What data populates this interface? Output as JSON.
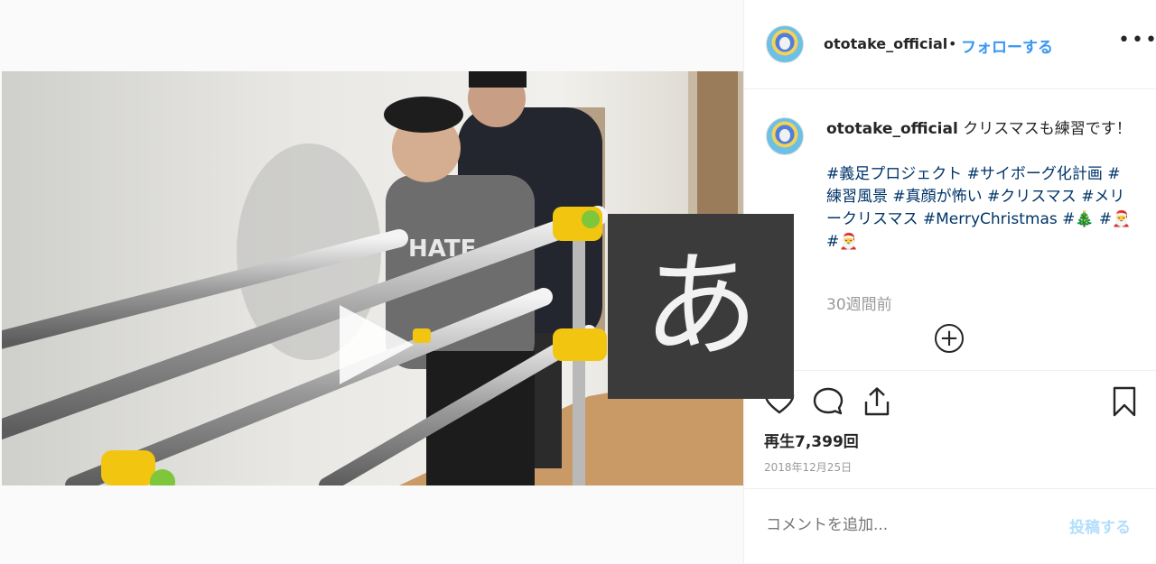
{
  "post": {
    "username": "ototake_official",
    "separator": "•",
    "follow_label": "フォローする",
    "more_label": "•••",
    "caption_text": "クリスマスも練習です！",
    "hashtags": "#義足プロジェクト #サイボーグ化計画 #練習風景 #真顔が怖い #クリスマス #メリークリスマス #MerryChristmas #🎄 #🎅 #🎅",
    "time_ago": "30週間前",
    "load_more": "+",
    "views": "再生7,399回",
    "date": "2018年12月25日"
  },
  "comment": {
    "placeholder": "コメントを追加...",
    "post_label": "投稿する"
  },
  "ime": {
    "char": "あ"
  },
  "colors": {
    "accent": "#3897f0",
    "hashtag": "#003569",
    "muted": "#999999",
    "post_disabled": "#b2dffc"
  }
}
